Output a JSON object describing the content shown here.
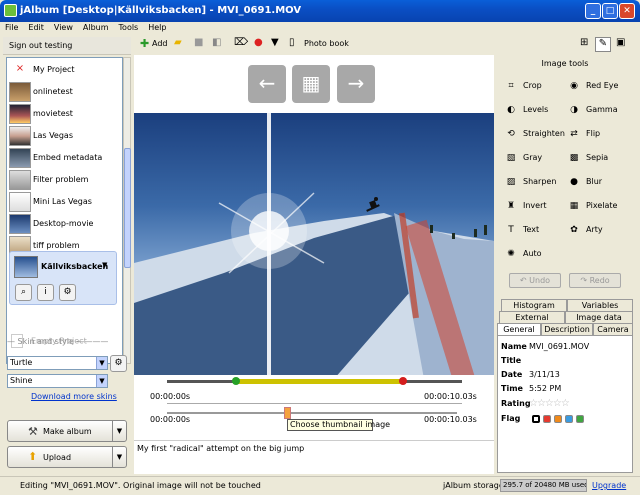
{
  "window": {
    "title": "jAlbum [Desktop|Källviksbacken] - MVI_0691.MOV"
  },
  "menu": [
    "File",
    "Edit",
    "View",
    "Album",
    "Tools",
    "Help"
  ],
  "sidebar": {
    "signout": "Sign out testing",
    "items": [
      {
        "label": "My Project",
        "icon": "close-icon"
      },
      {
        "label": "onlinetest",
        "icon": "folder-thumb"
      },
      {
        "label": "movietest",
        "icon": "folder-thumb"
      },
      {
        "label": "Las Vegas",
        "icon": "folder-thumb"
      },
      {
        "label": "Embed metadata",
        "icon": "folder-thumb"
      },
      {
        "label": "Filter problem",
        "icon": "folder-thumb"
      },
      {
        "label": "Mini Las Vegas",
        "icon": "folder-thumb"
      },
      {
        "label": "Desktop-movie",
        "icon": "folder-thumb"
      },
      {
        "label": "tiff problem",
        "icon": "folder-thumb"
      }
    ],
    "selected": {
      "label": "Källviksbacken"
    },
    "empty_project": "Empty Project",
    "skin_header": "Skin and style",
    "skin": "Turtle",
    "style": "Shine",
    "download_skins": "Download more skins",
    "make_album": "Make album",
    "upload": "Upload"
  },
  "toolbar": {
    "add": "Add",
    "photo_book": "Photo book"
  },
  "viewer": {
    "time_start": "00:00:00s",
    "time_end": "00:00:10.03s",
    "thumb_start": "00:00:00s",
    "thumb_end": "00:00:10.03s",
    "tooltip": "Choose thumbnail image",
    "caption": "My first \"radical\" attempt on the big jump"
  },
  "image_tools": {
    "header": "Image tools",
    "left": [
      "Crop",
      "Levels",
      "Straighten",
      "Gray",
      "Sharpen",
      "Invert",
      "Text",
      "Auto"
    ],
    "right": [
      "Red Eye",
      "Gamma",
      "Flip",
      "Sepia",
      "Blur",
      "Pixelate",
      "Arty"
    ],
    "undo": "Undo",
    "redo": "Redo"
  },
  "tabs": {
    "row1": [
      "Histogram",
      "Variables"
    ],
    "row2": [
      "External",
      "Image data"
    ],
    "row3": [
      "General",
      "Description",
      "Camera"
    ]
  },
  "properties": {
    "name_label": "Name",
    "name": "MVI_0691.MOV",
    "title_label": "Title",
    "title": "",
    "date_label": "Date",
    "date": "3/11/13",
    "time_label": "Time",
    "time": "5:52 PM",
    "rating_label": "Rating",
    "flag_label": "Flag",
    "flag_colors": [
      "#ffffff",
      "#e53a2f",
      "#f08a1c",
      "#3a9be0",
      "#3fa640"
    ]
  },
  "status": {
    "message": "Editing \"MVI_0691.MOV\". Original image will not be touched",
    "storage_label": "jAlbum storage:",
    "storage_value": "295.7 of 20480 MB used",
    "upgrade": "Upgrade"
  }
}
